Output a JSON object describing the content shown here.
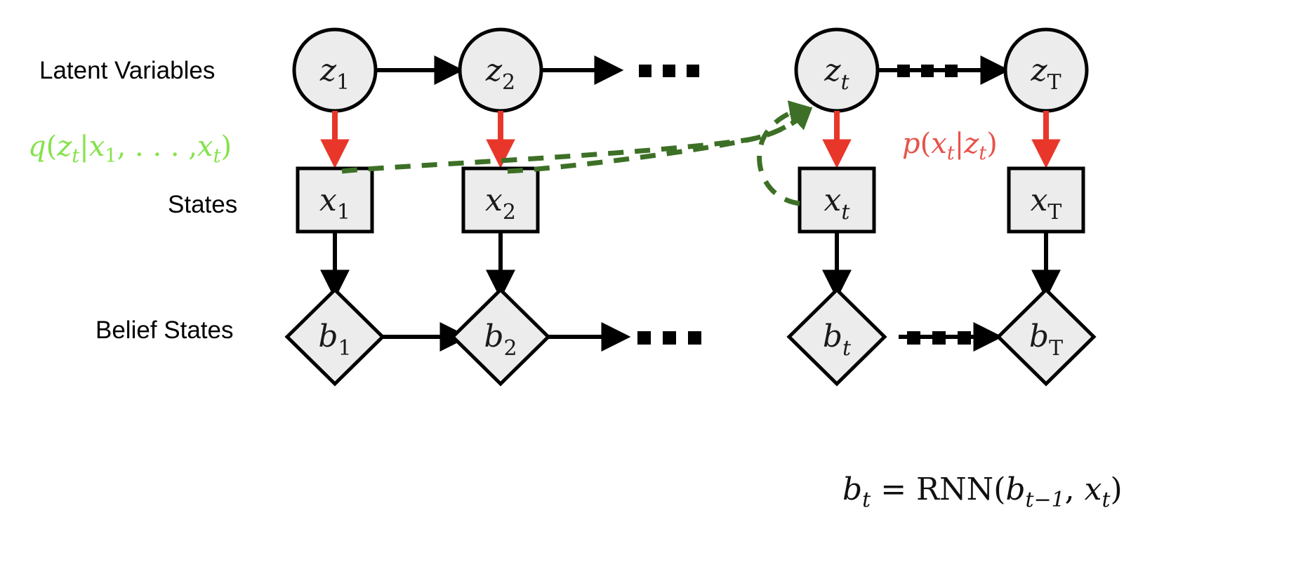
{
  "figure": {
    "title": "Sequential latent variable model with RNN belief states",
    "background": "#ffffff"
  },
  "colors": {
    "node_fill": "#ececec",
    "node_stroke": "#000000",
    "edge_black": "#000000",
    "edge_red": "#e8372a",
    "edge_green_dashed": "#3d7026",
    "label_green": "#84e24a",
    "label_red": "#e8524a"
  },
  "row_labels": {
    "latent": "Latent Variables",
    "states": "States",
    "belief": "Belief States"
  },
  "rows": {
    "latent": {
      "shape": "circle",
      "nodes": [
        {
          "base": "z",
          "sub": "1",
          "sub_style": "normal"
        },
        {
          "base": "z",
          "sub": "2",
          "sub_style": "normal"
        },
        {
          "base": "z",
          "sub": "t",
          "sub_style": "italic"
        },
        {
          "base": "z",
          "sub": "T",
          "sub_style": "normal"
        }
      ],
      "ellipses": [
        "...",
        "..."
      ]
    },
    "states": {
      "shape": "square",
      "nodes": [
        {
          "base": "x",
          "sub": "1",
          "sub_style": "normal"
        },
        {
          "base": "x",
          "sub": "2",
          "sub_style": "normal"
        },
        {
          "base": "x",
          "sub": "t",
          "sub_style": "italic"
        },
        {
          "base": "x",
          "sub": "T",
          "sub_style": "normal"
        }
      ],
      "ellipses": []
    },
    "belief": {
      "shape": "diamond",
      "nodes": [
        {
          "base": "b",
          "sub": "1",
          "sub_style": "normal"
        },
        {
          "base": "b",
          "sub": "2",
          "sub_style": "normal"
        },
        {
          "base": "b",
          "sub": "t",
          "sub_style": "italic"
        },
        {
          "base": "b",
          "sub": "T",
          "sub_style": "normal"
        }
      ],
      "ellipses": [
        "...",
        "..."
      ]
    }
  },
  "annotations": {
    "inference_label": {
      "text": "q(z_t|x_1, ..., x_t)",
      "color": "#84e24a",
      "parts": {
        "q": "q",
        "open": "(",
        "z": "z",
        "z_sub": "t",
        "bar": "|",
        "x": "x",
        "x_sub": "1",
        "comma_dots": ", . . . ,",
        "x2": "x",
        "x2_sub": "t",
        "close": ")"
      }
    },
    "generative_label": {
      "text": "p(x_t|z_t)",
      "color": "#e8524a",
      "parts": {
        "p": "p",
        "open": "(",
        "x": "x",
        "x_sub": "t",
        "bar": "|",
        "z": "z",
        "z_sub": "t",
        "close": ")"
      }
    },
    "rnn_equation": {
      "text": "b_t = RNN(b_{t-1}, x_t)",
      "parts": {
        "b": "b",
        "b_sub": "t",
        "eq": "=",
        "rnn": "RNN",
        "open": "(",
        "b2": "b",
        "b2_sub": "t−1",
        "comma": ",",
        "x": "x",
        "x_sub": "t",
        "close": ")"
      }
    }
  },
  "edges": {
    "latent_chain": "z_1 → z_2 → ... → z_t → ... → z_T",
    "emission": "z_i → x_i (red, generative)",
    "belief_update": "x_i → b_i (black)",
    "belief_chain": "b_1 → b_2 → ... → b_t → ... → b_T",
    "inference": "x_1, x_2, x_t → z_t (dark green dashed)"
  }
}
